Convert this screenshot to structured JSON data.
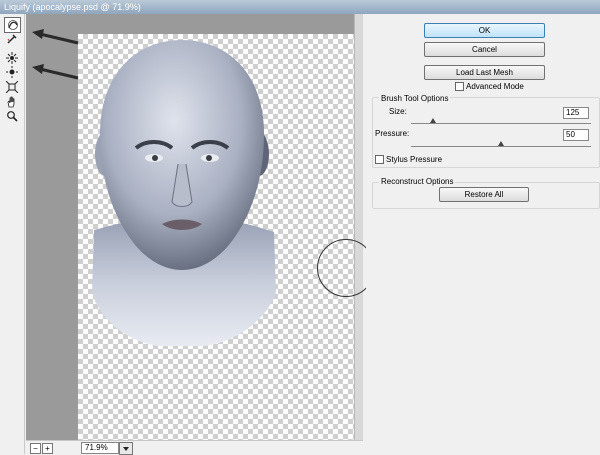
{
  "window": {
    "title": "Liquify (apocalypse.psd @ 71.9%)"
  },
  "tools": [
    {
      "name": "forward-warp-tool",
      "active": true
    },
    {
      "name": "reconstruct-tool",
      "active": false
    },
    {
      "name": "pucker-tool",
      "active": false
    },
    {
      "name": "bloat-tool",
      "active": false
    },
    {
      "name": "push-left-tool",
      "active": false
    },
    {
      "name": "hand-tool",
      "active": false
    },
    {
      "name": "zoom-tool",
      "active": false
    }
  ],
  "status": {
    "zoom_out": "−",
    "zoom_in": "+",
    "zoom_value": "71.9%"
  },
  "panel": {
    "ok_label": "OK",
    "cancel_label": "Cancel",
    "load_mesh_label": "Load Last Mesh",
    "advanced_mode_label": "Advanced Mode",
    "brush_group_title": "Brush Tool Options",
    "size_label": "Size:",
    "size_value": "125",
    "size_fraction": 0.12,
    "pressure_label": "Pressure:",
    "pressure_value": "50",
    "pressure_fraction": 0.5,
    "stylus_label": "Stylus Pressure",
    "reconstruct_group_title": "Reconstruct Options",
    "restore_all_label": "Restore All"
  }
}
